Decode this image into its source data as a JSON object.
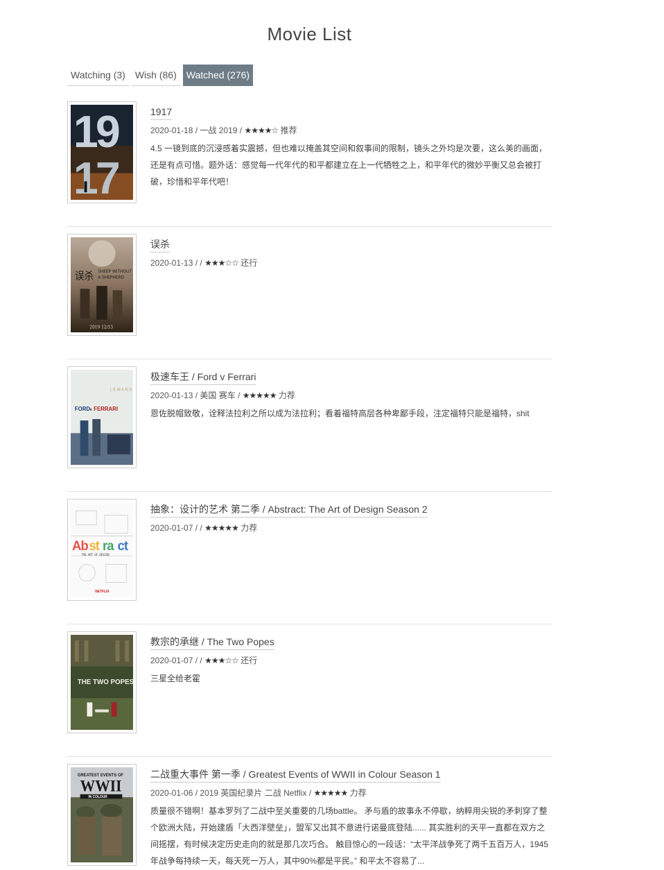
{
  "page": {
    "title": "Movie List"
  },
  "tabs": [
    {
      "label": "Watching (3)",
      "active": false
    },
    {
      "label": "Wish (86)",
      "active": false
    },
    {
      "label": "Watched (276)",
      "active": true
    }
  ],
  "movies": [
    {
      "title": "1917",
      "date": "2020-01-18",
      "info": "一战 2019",
      "stars": "★★★★☆",
      "rating_word": "推荐",
      "comment": "4.5 一镜到底的沉浸感着实震撼，但也难以掩盖其空间和叙事间的限制，镜头之外均是次要，这么美的画面，还是有点可惜。题外话：感觉每一代年代的和平都建立在上一代牺牲之上，和平年代的微妙平衡又总会被打破，珍惜和平年代吧！",
      "poster_text": "19 17"
    },
    {
      "title": "误杀",
      "date": "2020-01-13",
      "info": "",
      "stars": "★★★☆☆",
      "rating_word": "还行",
      "comment": "",
      "poster_text": "误杀 SHEEP WITHOUT A SHEPHERD 2019 12/13"
    },
    {
      "title": "极速车王 / Ford v Ferrari",
      "date": "2020-01-13",
      "info": "美国 赛车",
      "stars": "★★★★★",
      "rating_word": "力荐",
      "comment": "恩佐脱帽致敬，诠释法拉利之所以成为法拉利；看着福特高层各种卑鄙手段，注定福特只能是福特，shit",
      "poster_text": "FORD v FERRARI"
    },
    {
      "title": "抽象：设计的艺术 第二季 / Abstract: The Art of Design Season 2",
      "date": "2020-01-07",
      "info": "",
      "stars": "★★★★★",
      "rating_word": "力荐",
      "comment": "",
      "poster_text": "Abstract THE ART OF DESIGN NETFLIX"
    },
    {
      "title": "教宗的承继 / The Two Popes",
      "date": "2020-01-07",
      "info": "",
      "stars": "★★★☆☆",
      "rating_word": "还行",
      "comment": "三星全给老霍",
      "poster_text": "THE TWO POPES"
    },
    {
      "title": "二战重大事件 第一季 / Greatest Events of WWII in Colour Season 1",
      "date": "2020-01-06",
      "info": "2019 英国纪录片 二战 Netflix",
      "stars": "★★★★★",
      "rating_word": "力荐",
      "comment": "质量很不错啊！基本罗列了二战中至关重要的几场battle。 矛与盾的故事永不停歇，纳粹用尖锐的矛刺穿了整个欧洲大陆，开始建盾「大西洋壁垒」，盟军又出其不意进行诺曼底登陆...... 其实胜利的天平一直都在双方之间摇摆，有时候决定历史走向的就是那几次巧合。 触目惊心的一段话：“太平洋战争死了两千五百万人，1945年战争每持续一天，每天死一万人，其中90%都是平民。” 和平太不容易了...",
      "poster_text": "GREATEST EVENTS OF WWII IN COLOUR"
    }
  ]
}
